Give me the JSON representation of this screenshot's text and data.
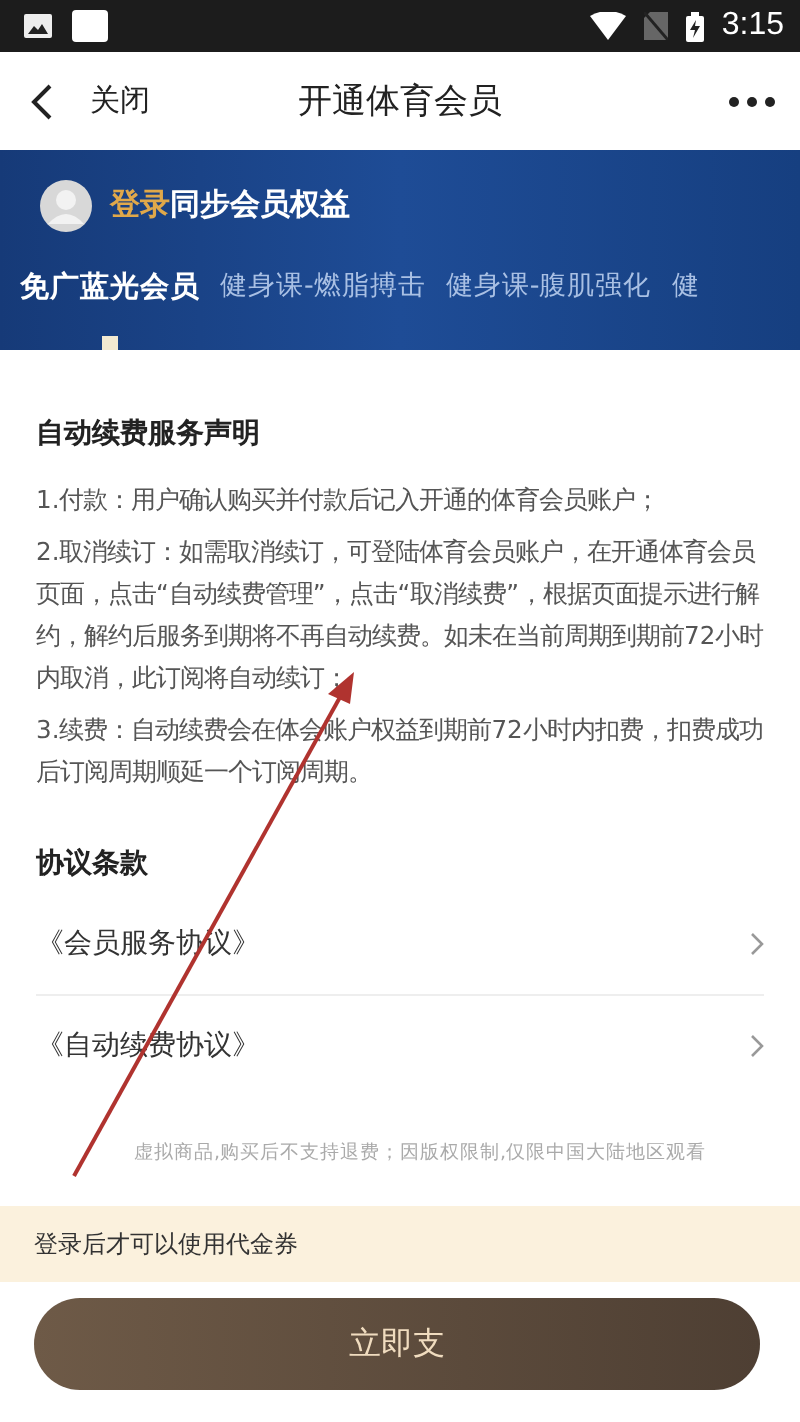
{
  "status_bar": {
    "time": "3:15"
  },
  "nav": {
    "back_label": "关闭",
    "title": "开通体育会员"
  },
  "banner": {
    "login_link": "登录",
    "login_text": "同步会员权益"
  },
  "tabs": [
    {
      "label": "免广蓝光会员",
      "selected": true
    },
    {
      "label": "健身课-燃脂搏击",
      "selected": false
    },
    {
      "label": "健身课-腹肌强化",
      "selected": false
    },
    {
      "label": "健",
      "selected": false
    }
  ],
  "statement": {
    "title": "自动续费服务声明",
    "paragraphs": [
      "1.付款：用户确认购买并付款后记入开通的体育会员账户；",
      "2.取消续订：如需取消续订，可登陆体育会员账户，在开通体育会员页面，点击“自动续费管理”，点击“取消续费”，根据页面提示进行解约，解约后服务到期将不再自动续费。如未在当前周期到期前72小时内取消，此订阅将自动续订；",
      "3.续费：自动续费会在体会账户权益到期前72小时内扣费，扣费成功后订阅周期顺延一个订阅周期。"
    ]
  },
  "agreements": {
    "title": "协议条款",
    "items": [
      "《会员服务协议》",
      "《自动续费协议》"
    ]
  },
  "footnote": "虚拟商品,购买后不支持退费；因版权限制,仅限中国大陆地区观看",
  "notice": "登录后才可以使用代金券",
  "pay_button": "立即支"
}
